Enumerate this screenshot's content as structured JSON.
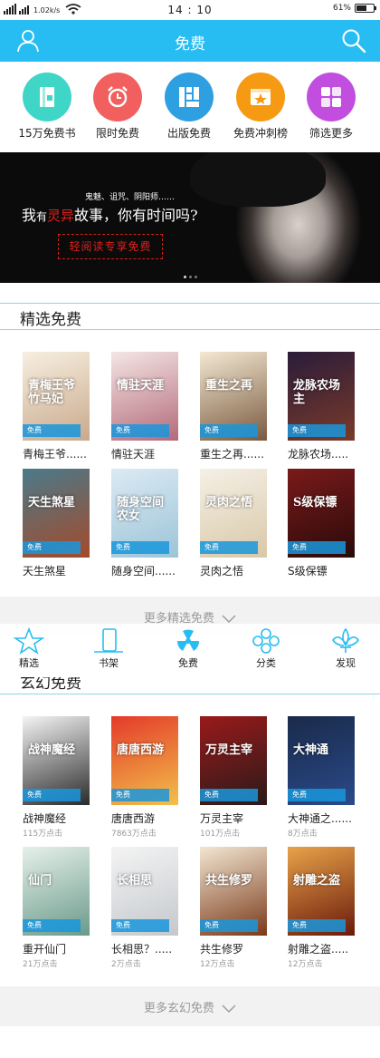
{
  "status_bar": {
    "speed": "1.02k/s",
    "time": "14 : 10",
    "battery": "61%",
    "battery_level": 0.61
  },
  "header": {
    "title": "免费"
  },
  "categories": [
    {
      "label": "15万免费书",
      "color": "#3fd6c8",
      "icon": "book-icon"
    },
    {
      "label": "限时免费",
      "color": "#f25f5f",
      "icon": "alarm-clock-icon"
    },
    {
      "label": "出版免费",
      "color": "#2e9fe0",
      "icon": "grid-icon"
    },
    {
      "label": "免费冲刺榜",
      "color": "#f59a12",
      "icon": "star-icon"
    },
    {
      "label": "筛选更多",
      "color": "#c24ee0",
      "icon": "filter-icon"
    }
  ],
  "banner": {
    "small_text": "鬼魅、诅咒、阴阳师……",
    "main_pre": "我",
    "main_small": "有",
    "main_red": "灵异",
    "main_post": "故事，你有时间吗?",
    "button": "轻阅读专享免费"
  },
  "section_selected": {
    "title": "精选免费",
    "books": [
      {
        "name": "青梅王爷......",
        "badge": "免费",
        "cover_text": "青梅王爷竹马妃",
        "bg1": "#f7efe0",
        "bg2": "#c9a98c"
      },
      {
        "name": "情驻天涯",
        "badge": "免费",
        "cover_text": "情驻天涯",
        "bg1": "#f4e6e4",
        "bg2": "#b36a7a"
      },
      {
        "name": "重生之再......",
        "badge": "免费",
        "cover_text": "重生之再",
        "bg1": "#f3e8d2",
        "bg2": "#7a5a40"
      },
      {
        "name": "龙脉农场.....",
        "badge": "免费",
        "cover_text": "龙脉农场主",
        "bg1": "#2a1c3a",
        "bg2": "#7a3a2a"
      },
      {
        "name": "天生煞星",
        "badge": "免费",
        "cover_text": "天生煞星",
        "bg1": "#4a7a8a",
        "bg2": "#a44a2a"
      },
      {
        "name": "随身空间......",
        "badge": "免费",
        "cover_text": "随身空间农女",
        "bg1": "#dbeaf3",
        "bg2": "#9cc4d8"
      },
      {
        "name": "灵肉之悟",
        "badge": "免费",
        "cover_text": "灵肉之悟",
        "bg1": "#f5f0e6",
        "bg2": "#d8c8a8"
      },
      {
        "name": "S级保镖",
        "badge": "免费",
        "cover_text": "S级保镖",
        "bg1": "#7a1a1a",
        "bg2": "#2a0a0a"
      }
    ],
    "more": "更多精选免费"
  },
  "section_fantasy": {
    "title": "玄幻免费",
    "books": [
      {
        "name": "战神魔经",
        "clicks": "115万点击",
        "badge": "免费",
        "cover_text": "战神魔经",
        "bg1": "#f4f4f4",
        "bg2": "#2a2a2a"
      },
      {
        "name": "唐唐西游",
        "clicks": "7863万点击",
        "badge": "免费",
        "cover_text": "唐唐西游",
        "bg1": "#e43a2a",
        "bg2": "#f2c04a"
      },
      {
        "name": "万灵主宰",
        "clicks": "101万点击",
        "badge": "免费",
        "cover_text": "万灵主宰",
        "bg1": "#9a1a1a",
        "bg2": "#2a1a1a"
      },
      {
        "name": "大神通之......",
        "clicks": "8万点击",
        "badge": "免费",
        "cover_text": "大神通",
        "bg1": "#1a2a4a",
        "bg2": "#2a4a8a"
      },
      {
        "name": "重开仙门",
        "clicks": "21万点击",
        "badge": "免费",
        "cover_text": "仙门",
        "bg1": "#e6f0ea",
        "bg2": "#6a9a8a"
      },
      {
        "name": "长相思？.....",
        "clicks": "2万点击",
        "badge": "免费",
        "cover_text": "长相思",
        "bg1": "#f4f4f4",
        "bg2": "#c4c8cc"
      },
      {
        "name": "共生修罗",
        "clicks": "12万点击",
        "badge": "免费",
        "cover_text": "共生修罗",
        "bg1": "#f2e6d2",
        "bg2": "#7a3a1a"
      },
      {
        "name": "射雕之盗.....",
        "clicks": "12万点击",
        "badge": "免费",
        "cover_text": "射雕之盗",
        "bg1": "#e8a24a",
        "bg2": "#6a1a0a"
      }
    ],
    "more": "更多玄幻免费"
  },
  "bottom_nav": [
    {
      "label": "精选",
      "icon": "star-outline-icon",
      "active": false
    },
    {
      "label": "书架",
      "icon": "bookshelf-icon",
      "active": false
    },
    {
      "label": "免费",
      "icon": "radiation-icon",
      "active": true
    },
    {
      "label": "分类",
      "icon": "clover-icon",
      "active": false
    },
    {
      "label": "发现",
      "icon": "fleur-de-lis-icon",
      "active": false
    }
  ]
}
